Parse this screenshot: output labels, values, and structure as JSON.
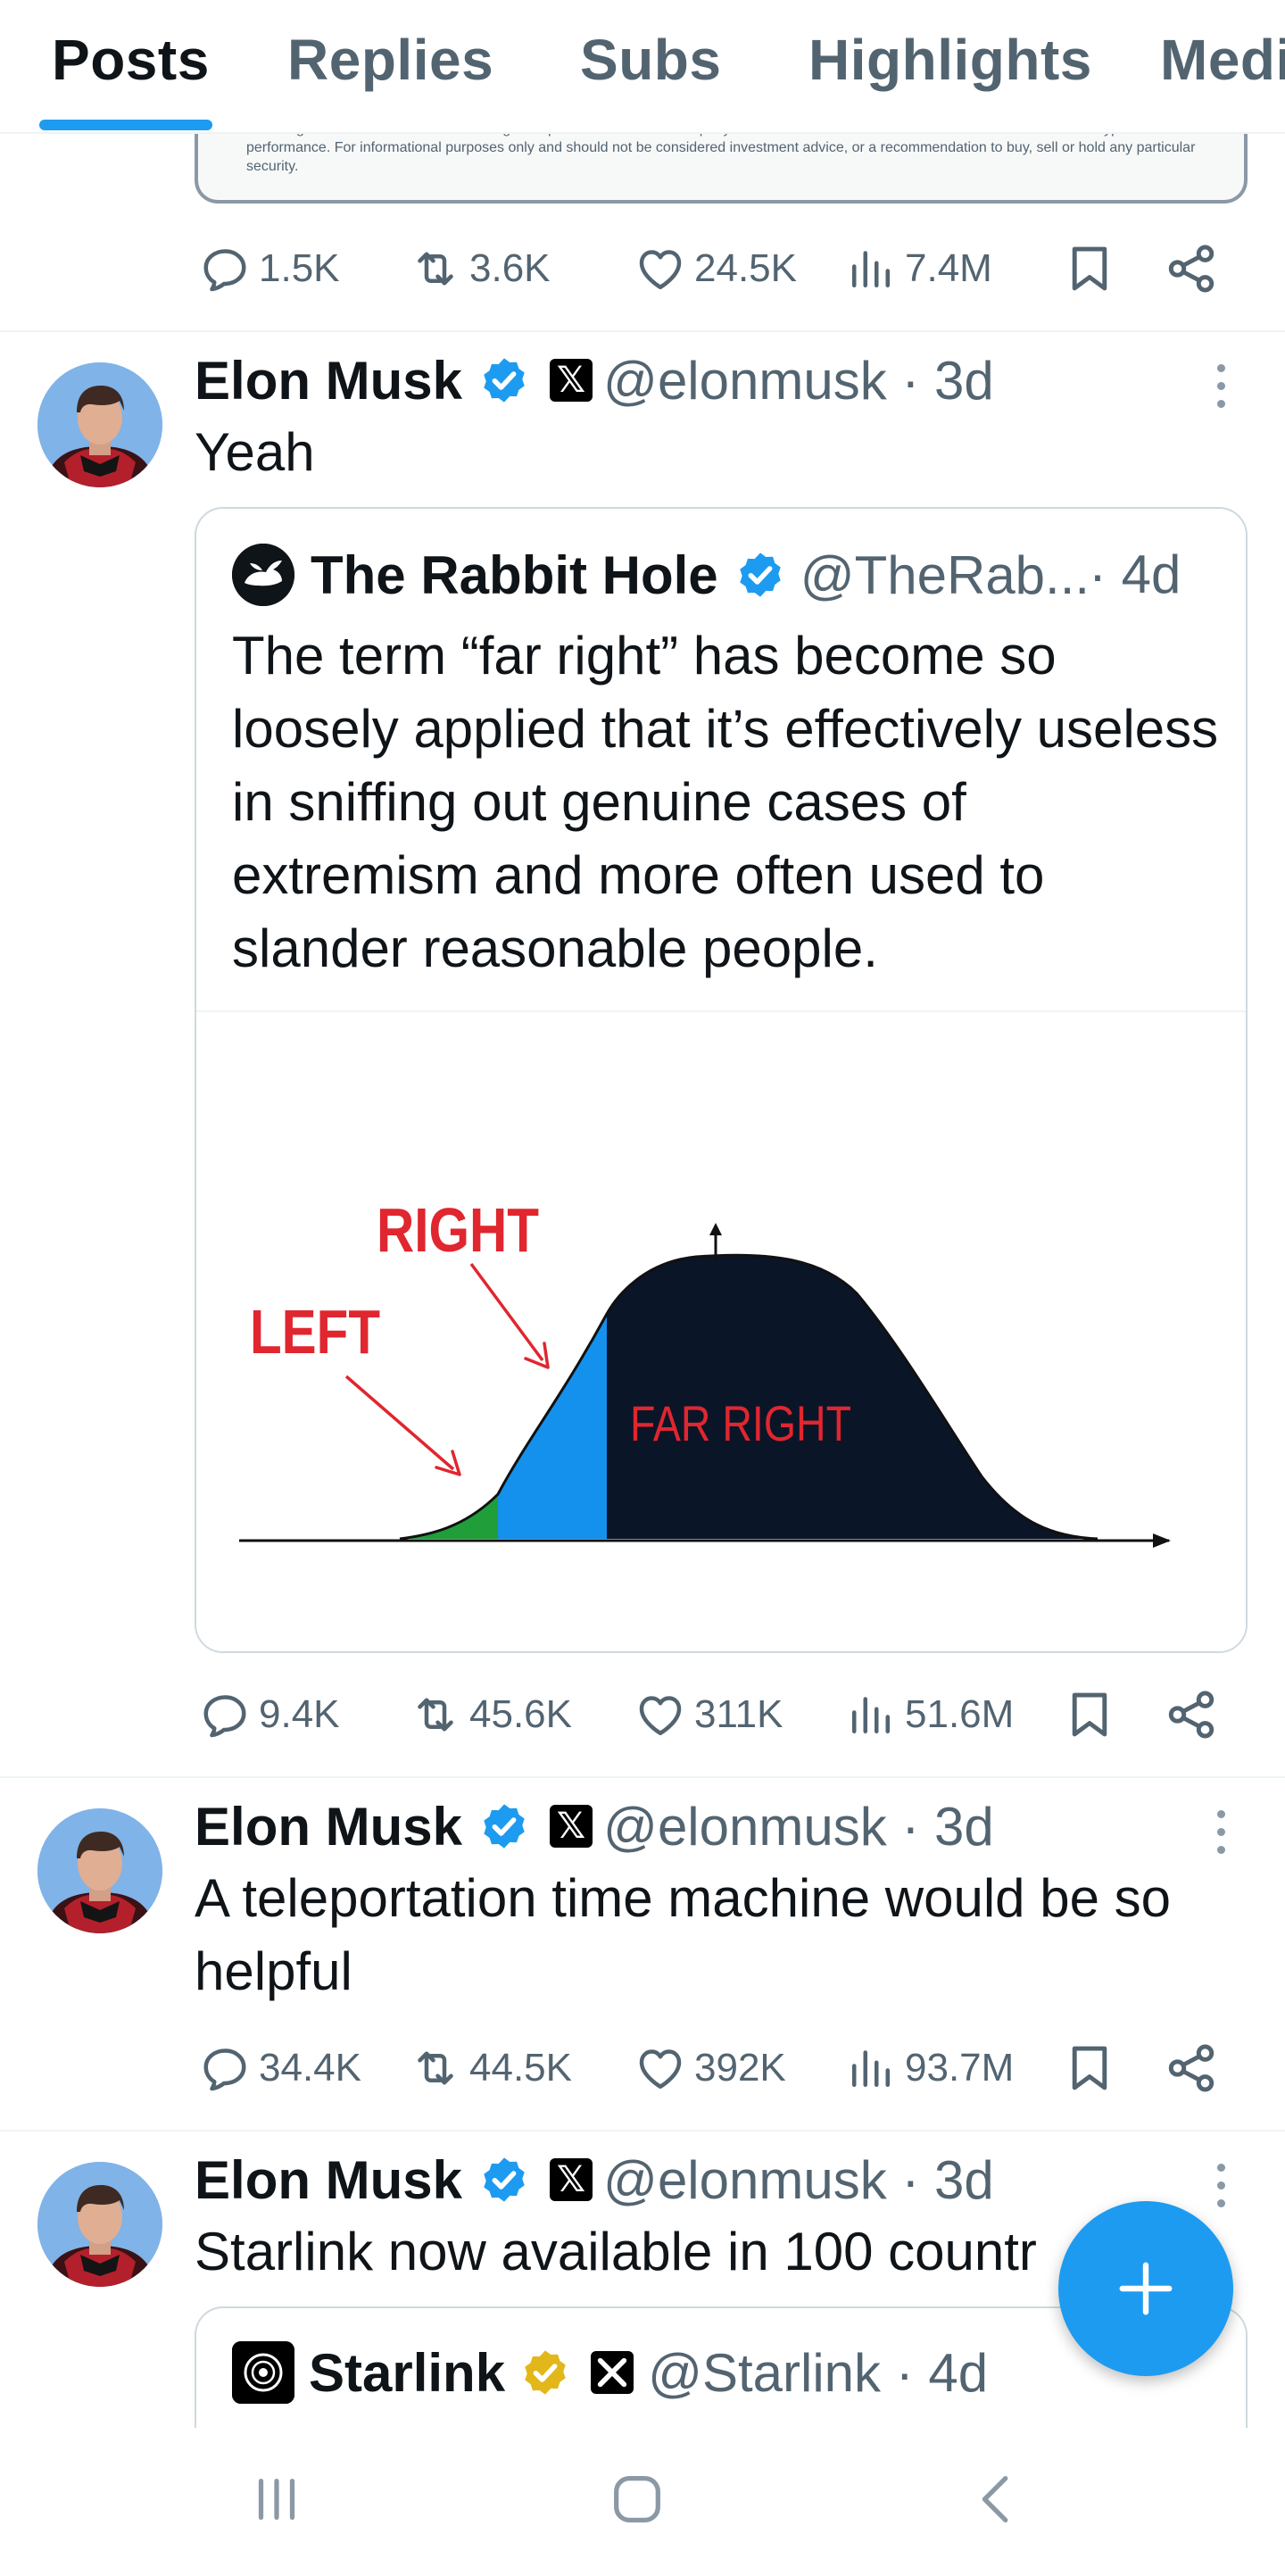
{
  "tabs": [
    {
      "label": "Posts",
      "active": true
    },
    {
      "label": "Replies"
    },
    {
      "label": "Subs"
    },
    {
      "label": "Highlights"
    },
    {
      "label": "Medi"
    }
  ],
  "first_post": {
    "disclaimer": "modeling that reflects our biases and long-term positive view of the company. Please see additional disclosure below on forecasts and hypothetical performance. For informational purposes only and should not be considered investment advice, or a recommendation to buy, sell or hold any particular security.",
    "stats": {
      "replies": "1.5K",
      "reposts": "3.6K",
      "likes": "24.5K",
      "views": "7.4M"
    }
  },
  "posts": [
    {
      "name": "Elon Musk",
      "badge": "𝕏",
      "handle": "@elonmusk · 3d",
      "text": "Yeah",
      "quote": {
        "name": "The Rabbit Hole",
        "handle": "@TheRab...",
        "time": "· 4d",
        "text": "The term “far right” has become so loosely applied that it’s effectively useless in sniffing out genuine cases of extremism and more often used to slander reasonable people.",
        "image": {
          "labels": {
            "left": "LEFT",
            "right": "RIGHT",
            "far_right": "FAR RIGHT"
          },
          "colors": {
            "left": "#1f9e3a",
            "right": "#1391ec",
            "far_right": "#0b1528",
            "text": "#e0262f"
          }
        }
      },
      "stats": {
        "replies": "9.4K",
        "reposts": "45.6K",
        "likes": "311K",
        "views": "51.6M"
      }
    },
    {
      "name": "Elon Musk",
      "badge": "𝕏",
      "handle": "@elonmusk · 3d",
      "text": "A teleportation time machine would be so helpful",
      "stats": {
        "replies": "34.4K",
        "reposts": "44.5K",
        "likes": "392K",
        "views": "93.7M"
      }
    },
    {
      "name": "Elon Musk",
      "badge": "𝕏",
      "handle": "@elonmusk · 3d",
      "text": "Starlink now available in 100 countr",
      "quote": {
        "name": "Starlink",
        "handle": "@Starlink · 4d"
      }
    }
  ],
  "colors": {
    "accent": "#1d9bf0",
    "muted": "#536471",
    "gold": "#e2b719"
  },
  "icons": [
    "reply-icon",
    "repost-icon",
    "like-icon",
    "views-icon",
    "bookmark-icon",
    "share-icon",
    "verified-icon",
    "more-icon",
    "compose-icon"
  ]
}
